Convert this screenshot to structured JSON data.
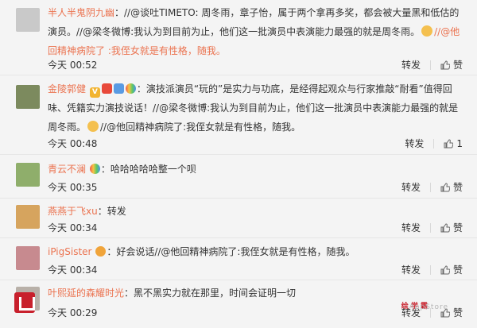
{
  "comments": [
    {
      "user": "半人半鬼阴九幽",
      "text": "：//@谈吐TIMETO: 周冬雨，章子怡，属于两个拿再多奖，都会被大量黑和低估的演员。//@梁冬微博:我认为到目前为止，他们这一批演员中表演能力最强的就是周冬雨。",
      "text2": "//@他回精神病院了 :我侄女就是有性格，随我。",
      "time": "今天 00:52",
      "repost": "转发",
      "likes": "赞",
      "avatar_color": "#c9c9c9"
    },
    {
      "user": "金陵郭健",
      "text": "：演技派演员“玩的”是实力与功底，是经得起观众与行家推敲“耐看”值得回味、凭籍实力演技说话！//@梁冬微博:我认为到目前为止，他们这一批演员中表演能力最强的就是周冬雨。",
      "text2": "//@他回精神病院了:我侄女就是有性格，随我。",
      "time": "今天 00:48",
      "repost": "转发",
      "likes": "1",
      "avatar_color": "#7c8a5e"
    },
    {
      "user": "青云不澜",
      "text": "：哈哈哈哈哈整一个呗",
      "time": "今天 00:35",
      "repost": "转发",
      "likes": "赞",
      "avatar_color": "#8fae6b"
    },
    {
      "user": "燕燕于飞xu",
      "text": "：转发",
      "time": "今天 00:34",
      "repost": "转发",
      "likes": "赞",
      "avatar_color": "#d6a45e"
    },
    {
      "user": "iPigSister",
      "text": "：好会说话//@他回精神病院了:我侄女就是有性格，随我。",
      "time": "今天 00:34",
      "repost": "转发",
      "likes": "赞",
      "avatar_color": "#c78a8f"
    },
    {
      "user": "叶熙延的森耀时光",
      "text": "：黑不黑实力就在那里，时间会证明一切",
      "time": "今天 00:29",
      "repost": "转发",
      "likes": "赞",
      "avatar_color": "#b8b0a8"
    }
  ],
  "watermark": {
    "tag": "绘 学 霸",
    "text": "AppStore"
  },
  "colors": {
    "username": "#eb7350",
    "text": "#333333",
    "background": "#f4f4f4"
  }
}
